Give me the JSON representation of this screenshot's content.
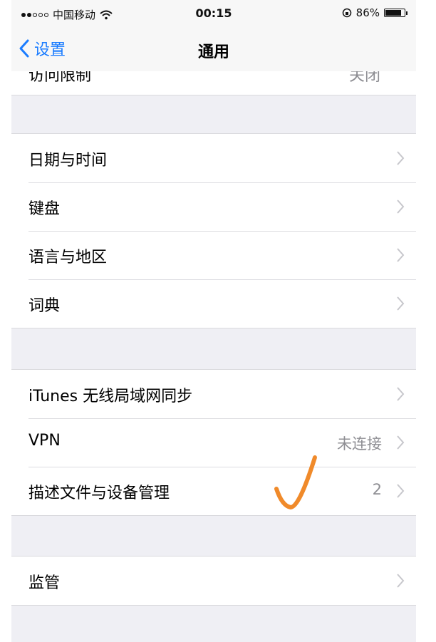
{
  "status_bar": {
    "carrier": "中国移动",
    "time": "00:15",
    "battery_percent": "86%",
    "battery_level": 0.86
  },
  "nav": {
    "back_label": "设置",
    "title": "通用"
  },
  "partial_row": {
    "label": "访问限制",
    "value": "关闭"
  },
  "groups": [
    {
      "rows": [
        {
          "label": "日期与时间",
          "value": ""
        },
        {
          "label": "键盘",
          "value": ""
        },
        {
          "label": "语言与地区",
          "value": ""
        },
        {
          "label": "词典",
          "value": ""
        }
      ]
    },
    {
      "rows": [
        {
          "label": "iTunes 无线局域网同步",
          "value": ""
        },
        {
          "label": "VPN",
          "value": "未连接"
        },
        {
          "label": "描述文件与设备管理",
          "value": "2"
        }
      ]
    },
    {
      "rows": [
        {
          "label": "监管",
          "value": ""
        }
      ]
    }
  ],
  "colors": {
    "accent": "#1a7cff",
    "annotation": "#f08a2a",
    "background": "#efeff4"
  },
  "icons": [
    "wifi-icon",
    "orientation-lock-icon",
    "battery-icon",
    "back-chevron-icon",
    "chevron-right-icon",
    "checkmark-annotation"
  ]
}
